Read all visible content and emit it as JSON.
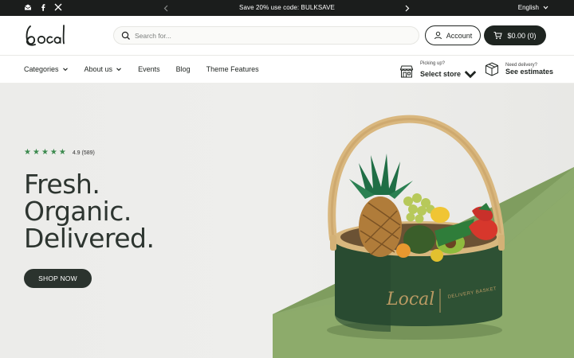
{
  "announcement": {
    "promo": "Save 20% use code: BULKSAVE",
    "language": "English"
  },
  "header": {
    "logo_text": "Local",
    "search_placeholder": "Search for...",
    "account_label": "Account",
    "cart_label": "$0.00 (0)"
  },
  "nav": {
    "items": [
      {
        "label": "Categories",
        "dropdown": true
      },
      {
        "label": "About us",
        "dropdown": true
      },
      {
        "label": "Events",
        "dropdown": false
      },
      {
        "label": "Blog",
        "dropdown": false
      },
      {
        "label": "Theme Features",
        "dropdown": false
      }
    ],
    "store": {
      "small": "Picking up?",
      "main": "Select store"
    },
    "delivery": {
      "small": "Need delivery?",
      "main": "See estimates"
    }
  },
  "hero": {
    "rating": "4.9 (589)",
    "star_count": 5,
    "headline": [
      "Fresh.",
      "Organic.",
      "Delivered."
    ],
    "cta": "SHOP NOW",
    "basket_brand": "Local",
    "basket_tag": "DELIVERY BASKET"
  },
  "colors": {
    "topbar": "#1b1d1c",
    "accent_green": "#3b8a4e",
    "dark_button": "#2b332e",
    "hero_bg": "#ececea",
    "basket_green": "#2e5134",
    "pedestal_green": "#8eac6c"
  }
}
